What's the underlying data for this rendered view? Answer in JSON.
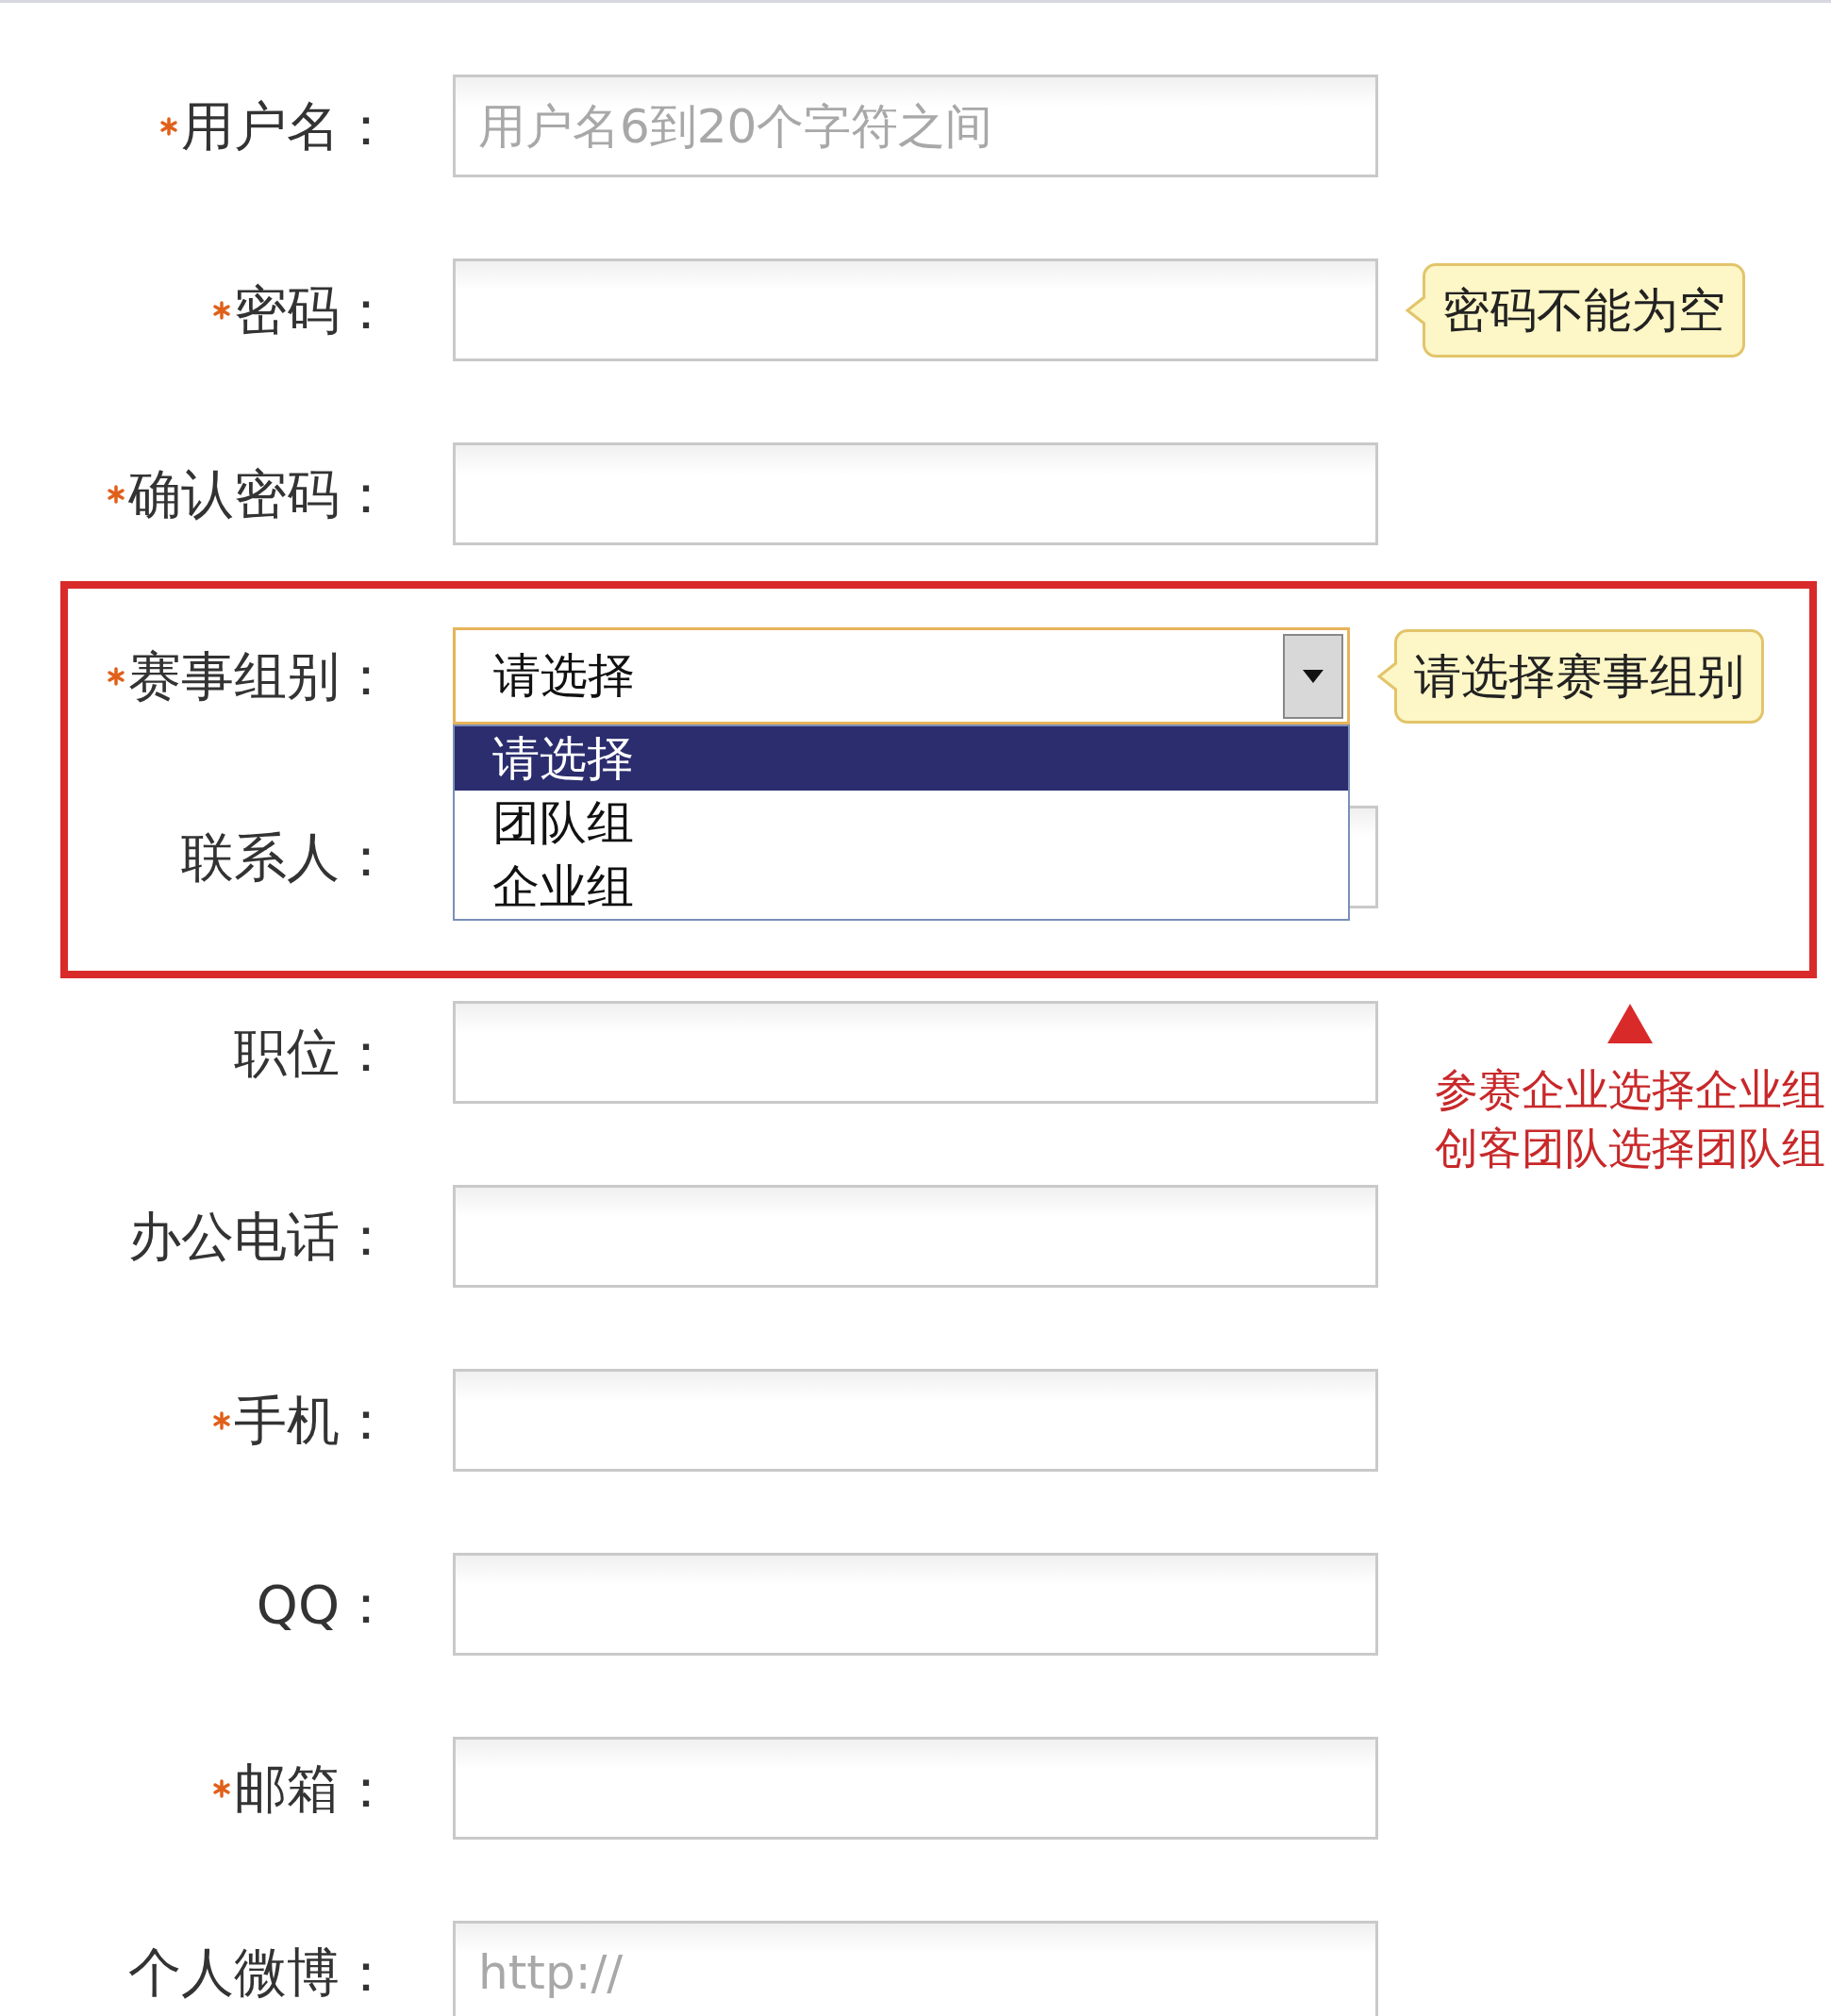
{
  "fields": [
    {
      "kind": "text",
      "label": "用户名：",
      "required": true,
      "placeholder": "用户名6到20个字符之间"
    },
    {
      "kind": "text",
      "label": "密码：",
      "required": true,
      "tooltip": "密码不能为空"
    },
    {
      "kind": "text",
      "label": "确认密码：",
      "required": true
    },
    {
      "kind": "select",
      "highlighted": true,
      "label": "赛事组别：",
      "required": true,
      "value": "请选择",
      "tooltip": "请选择赛事组别",
      "open": true,
      "options": [
        {
          "label": "请选择",
          "selected": true
        },
        {
          "label": "团队组",
          "selected": false
        },
        {
          "label": "企业组",
          "selected": false
        }
      ]
    },
    {
      "kind": "text",
      "highlighted": true,
      "label": "联系人：",
      "required": false
    },
    {
      "kind": "text",
      "label": "职位：",
      "required": false
    },
    {
      "kind": "text",
      "label": "办公电话：",
      "required": false
    },
    {
      "kind": "text",
      "label": "手机：",
      "required": true
    },
    {
      "kind": "text",
      "label": "QQ：",
      "required": false
    },
    {
      "kind": "text",
      "label": "邮箱：",
      "required": true
    },
    {
      "kind": "text",
      "label": "个人微博：",
      "required": false,
      "placeholder": "http://"
    }
  ],
  "annotation": {
    "lines": [
      "参赛企业选择企业组",
      "创客团队选择团队组"
    ]
  }
}
